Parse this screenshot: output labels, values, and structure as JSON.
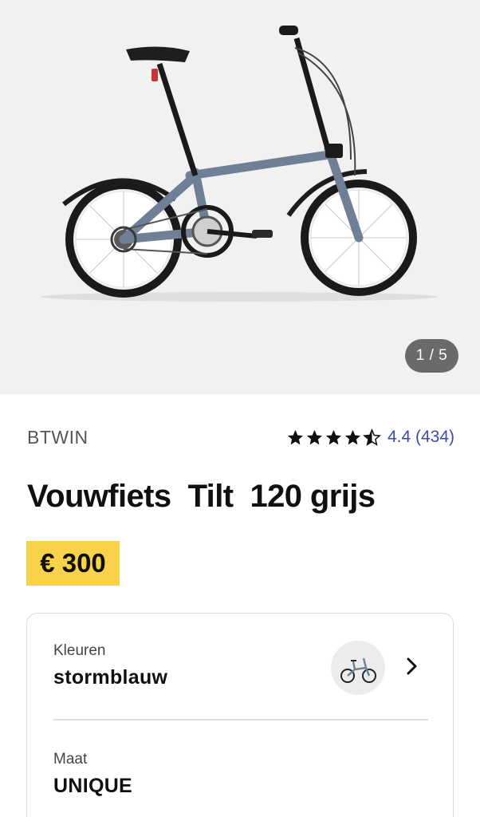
{
  "gallery": {
    "counter": "1 / 5",
    "image_icon": "folding-bike-photo"
  },
  "product": {
    "brand": "BTWIN",
    "rating": 4.4,
    "rating_text": "4.4 (434)",
    "stars_icon": "star-icon",
    "title": "Vouwfiets  Tilt  120 grijs",
    "price": "€ 300"
  },
  "options": {
    "colors_label": "Kleuren",
    "colors_value": "stormblauw",
    "size_label": "Maat",
    "size_value": "UNIQUE",
    "chevron_icon": "chevron-right-icon"
  },
  "colors": {
    "price_highlight": "#f9d24b",
    "rating_link": "#3d4ba0",
    "bike_frame": "#6f8096"
  }
}
